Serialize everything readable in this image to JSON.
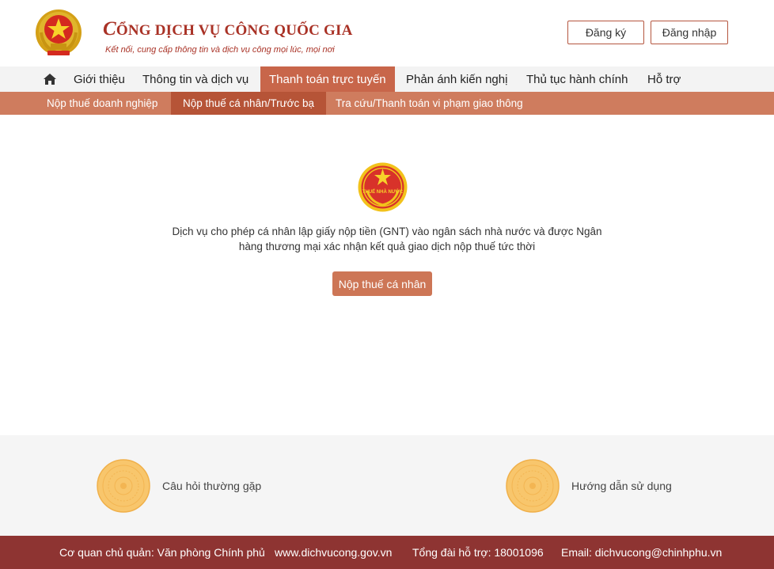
{
  "header": {
    "brand_title_initial": "C",
    "brand_title_rest": "ỔNG DỊCH VỤ CÔNG QUỐC GIA",
    "brand_subtitle": "Kết nối, cung cấp thông tin và dịch vụ công mọi lúc, mọi nơi",
    "register_label": "Đăng ký",
    "login_label": "Đăng nhập"
  },
  "main_nav": {
    "items": [
      {
        "label": "Giới thiệu"
      },
      {
        "label": "Thông tin và dịch vụ"
      },
      {
        "label": "Thanh toán trực tuyến"
      },
      {
        "label": "Phản ánh kiến nghị"
      },
      {
        "label": "Thủ tục hành chính"
      },
      {
        "label": "Hỗ trợ"
      }
    ],
    "active": "Thanh toán trực tuyến"
  },
  "sub_nav": {
    "items": [
      {
        "label": "Nộp thuế doanh nghiệp"
      },
      {
        "label": "Nộp thuế cá nhân/Trước bạ"
      },
      {
        "label": "Tra cứu/Thanh toán vi phạm giao thông"
      }
    ],
    "active": "Nộp thuế cá nhân/Trước bạ"
  },
  "content": {
    "emblem_text": "THUẾ NHÀ NƯỚC",
    "description_line1": "Dịch vụ cho phép cá nhân lập giấy nộp tiền (GNT) vào ngân sách nhà nước và được Ngân",
    "description_line2": "hàng thương mại xác nhận kết quả giao dịch nộp thuế tức thời",
    "button_label": "Nộp thuế cá nhân"
  },
  "links": [
    {
      "label": "Câu hỏi thường gặp",
      "icon": "medallion-icon"
    },
    {
      "label": "Hướng dẫn sử dụng",
      "icon": "medallion-icon"
    }
  ],
  "footer": {
    "agency": "Cơ quan chủ quản: Văn phòng Chính phủ",
    "website": "www.dichvucong.gov.vn",
    "hotline": "Tổng đài hỗ trợ: 18001096",
    "email": "Email: dichvucong@chinhphu.vn"
  },
  "colors": {
    "brand_red": "#a93226",
    "nav_active": "#c8664a",
    "subnav_bg": "#cf7c5e",
    "subnav_active": "#b65437",
    "button": "#cd7656",
    "footer_bg": "#8e3432",
    "links_bg": "#f5f5f5"
  }
}
